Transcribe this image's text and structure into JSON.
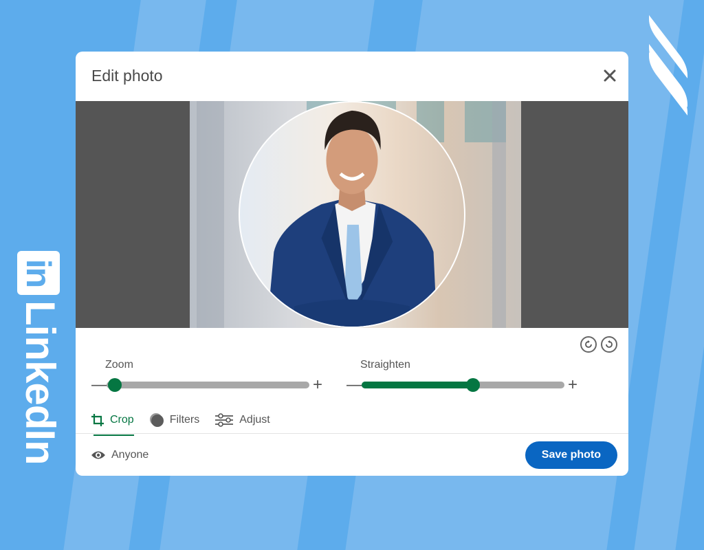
{
  "brand": {
    "name": "LinkedIn",
    "badge": "in"
  },
  "dialog": {
    "title": "Edit photo",
    "close_icon": "close-icon"
  },
  "editor": {
    "rotate_clockwise_icon": "rotate-clockwise-icon",
    "rotate_counterclockwise_icon": "rotate-counterclockwise-icon",
    "zoom": {
      "label": "Zoom",
      "value_fraction": 0.0,
      "minus": "—",
      "plus": "+"
    },
    "straighten": {
      "label": "Straighten",
      "value_fraction": 0.55,
      "minus": "—",
      "plus": "+"
    }
  },
  "tabs": [
    {
      "label": "Crop",
      "icon": "crop-icon",
      "active": true
    },
    {
      "label": "Filters",
      "icon": "filters-icon",
      "active": false
    },
    {
      "label": "Adjust",
      "icon": "sliders-icon",
      "active": false
    }
  ],
  "footer": {
    "visibility_label": "Anyone",
    "visibility_icon": "eye-icon",
    "save_label": "Save photo"
  },
  "colors": {
    "accent_green": "#057642",
    "primary_blue": "#0a66c2",
    "background_blue": "#5dacec"
  }
}
